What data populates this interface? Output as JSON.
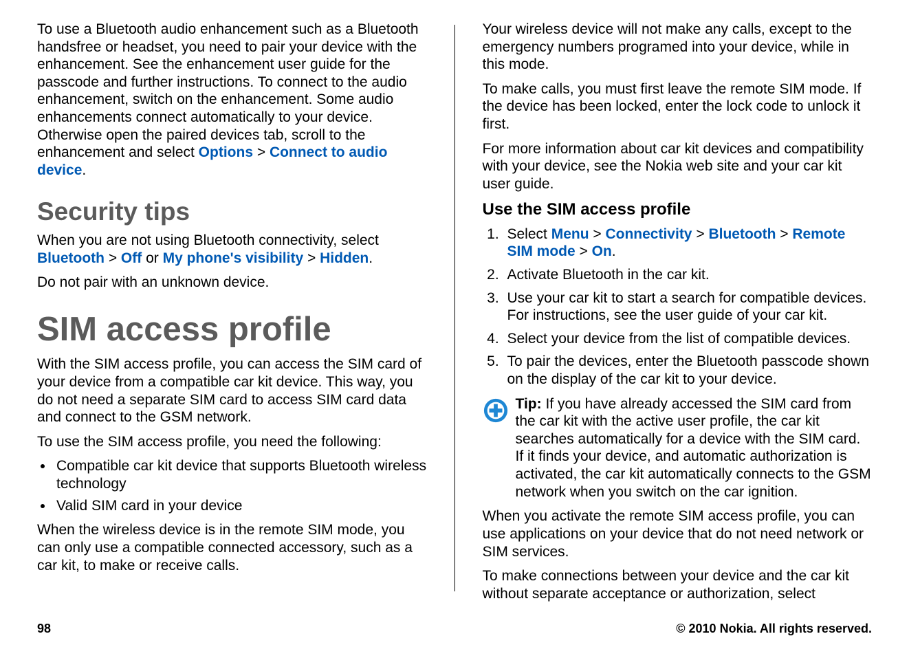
{
  "left": {
    "p1_a": "To use a Bluetooth audio enhancement such as a Bluetooth handsfree or headset, you need to pair your device with the enhancement. See the enhancement user guide for the passcode and further instructions. To connect to the audio enhancement, switch on the enhancement. Some audio enhancements connect automatically to your device. Otherwise open the paired devices tab, scroll to the enhancement and select ",
    "p1_options": "Options",
    "p1_gt1": " > ",
    "p1_connect": "Connect to audio device",
    "p1_end": ".",
    "h_security": "Security tips",
    "p2_a": "When you are not using Bluetooth connectivity, select ",
    "p2_bt": "Bluetooth",
    "p2_gt1": " > ",
    "p2_off": "Off",
    "p2_or": " or ",
    "p2_vis": "My phone's visibility",
    "p2_gt2": " > ",
    "p2_hidden": "Hidden",
    "p2_end": ".",
    "p3": "Do not pair with an unknown device.",
    "h_sim": "SIM access profile",
    "p4": "With the SIM access profile, you can access the SIM card of your device from a compatible car kit device. This way, you do not need a separate SIM card to access SIM card data and connect to the GSM network.",
    "p5": "To use the SIM access profile, you need the following:",
    "b1": "Compatible car kit device that supports Bluetooth wireless technology",
    "b2": "Valid SIM card in your device",
    "p6": "When the wireless device is in the remote SIM mode, you can only use a compatible connected accessory, such as a car kit, to make or receive calls."
  },
  "right": {
    "p1": "Your wireless device will not make any calls, except to the emergency numbers programed into your device, while in this mode.",
    "p2": "To make calls, you must first leave the remote SIM mode. If the device has been locked, enter the lock code to unlock it first.",
    "p3": "For more information about car kit devices and compatibility with your device, see the Nokia web site and your car kit user guide.",
    "h_use": "Use the SIM access profile",
    "s1_a": "Select ",
    "s1_menu": "Menu",
    "s1_gt1": " > ",
    "s1_conn": "Connectivity",
    "s1_gt2": " > ",
    "s1_bt": "Bluetooth",
    "s1_gt3": " > ",
    "s1_rsm": "Remote SIM mode",
    "s1_gt4": " > ",
    "s1_on": "On",
    "s1_end": ".",
    "s2": "Activate Bluetooth in the car kit.",
    "s3": "Use your car kit to start a search for compatible devices. For instructions, see the user guide of your car kit.",
    "s4": "Select your device from the list of compatible devices.",
    "s5": "To pair the devices, enter the Bluetooth passcode shown on the display of the car kit to your device.",
    "tip_label": "Tip: ",
    "tip_body": "If you have already accessed the SIM card from the car kit with the active user profile, the car kit searches automatically for a device with the SIM card. If it finds your device, and automatic authorization is activated, the car kit automatically connects to the GSM network when you switch on the car ignition.",
    "p4": "When you activate the remote SIM access profile, you can use applications on your device that do not need network or SIM services.",
    "p5": "To make connections between your device and the car kit without separate acceptance or authorization, select"
  },
  "footer": {
    "page_num": "98",
    "copyright": "© 2010 Nokia. All rights reserved."
  }
}
